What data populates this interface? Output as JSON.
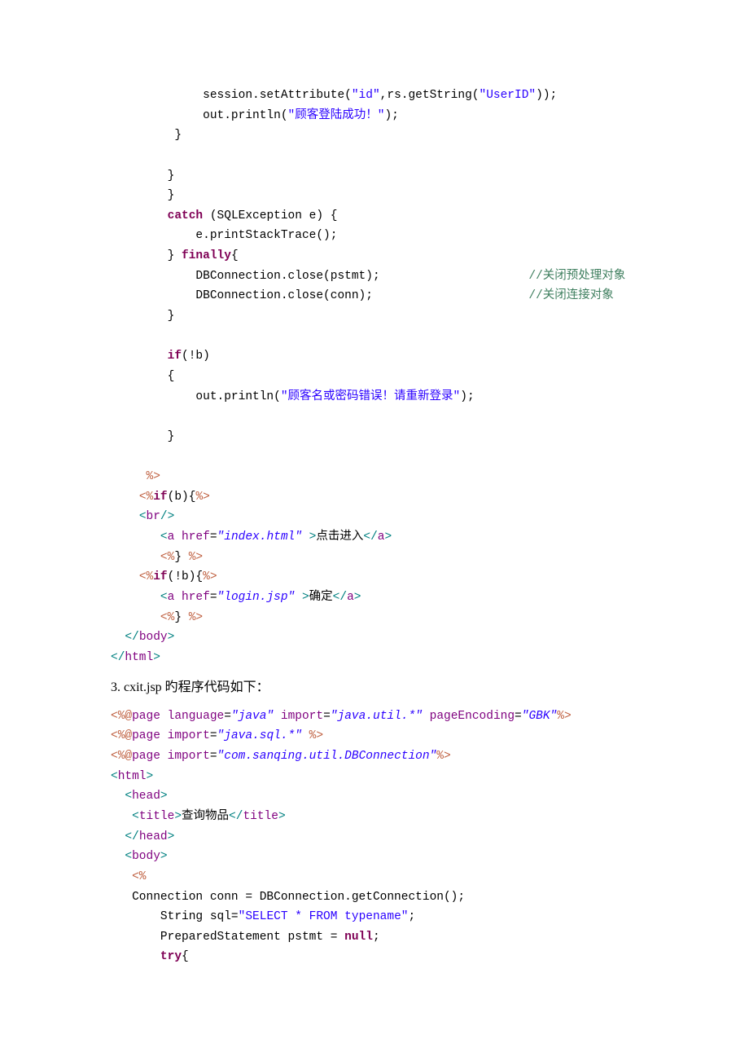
{
  "block1": {
    "l1_a": "             session.setAttribute(",
    "l1_b": "\"id\"",
    "l1_c": ",rs.getString(",
    "l1_d": "\"UserID\"",
    "l1_e": "));",
    "l2_a": "             out.println(",
    "l2_b": "\"顾客登陆成功！\"",
    "l2_c": ");",
    "l3": "         }",
    "l5": "        }",
    "l6": "        }",
    "l7_a": "        ",
    "l7_b": "catch",
    "l7_c": " (SQLException e) {",
    "l8": "            e.printStackTrace();",
    "l9_a": "        } ",
    "l9_b": "finally",
    "l9_c": "{",
    "l10_a": "            DBConnection.close(pstmt);                     ",
    "l10_b": "//关闭预处理对象",
    "l11_a": "            DBConnection.close(conn);                      ",
    "l11_b": "//关闭连接对象",
    "l12": "        }",
    "l14_a": "        ",
    "l14_b": "if",
    "l14_c": "(!b)",
    "l15": "        {",
    "l16_a": "            out.println(",
    "l16_b": "\"顾客名或密码错误！请重新登录\"",
    "l16_c": ");",
    "l18": "        }",
    "l20_a": "     ",
    "l20_b": "%>",
    "l21_a": "    ",
    "l21_b": "<%",
    "l21_c": "if",
    "l21_d": "(b){",
    "l21_e": "%>",
    "l22_a": "    ",
    "l22_b": "<",
    "l22_c": "br",
    "l22_d": "/>",
    "l23_a": "       ",
    "l23_b": "<",
    "l23_c": "a",
    "l23_d": " ",
    "l23_e": "href",
    "l23_f": "=",
    "l23_g": "\"index.html\"",
    "l23_h": " >",
    "l23_i": "点击进入",
    "l23_j": "</",
    "l23_k": "a",
    "l23_l": ">",
    "l24_a": "       ",
    "l24_b": "<%",
    "l24_c": "} ",
    "l24_d": "%>",
    "l25_a": "    ",
    "l25_b": "<%",
    "l25_c": "if",
    "l25_d": "(!b){",
    "l25_e": "%>",
    "l26_a": "       ",
    "l26_b": "<",
    "l26_c": "a",
    "l26_d": " ",
    "l26_e": "href",
    "l26_f": "=",
    "l26_g": "\"login.jsp\"",
    "l26_h": " >",
    "l26_i": "确定",
    "l26_j": "</",
    "l26_k": "a",
    "l26_l": ">",
    "l27_a": "       ",
    "l27_b": "<%",
    "l27_c": "} ",
    "l27_d": "%>",
    "l28_a": "  ",
    "l28_b": "</",
    "l28_c": "body",
    "l28_d": ">",
    "l29_b": "</",
    "l29_c": "html",
    "l29_d": ">"
  },
  "heading": "3. cxit.jsp 旳程序代码如下：",
  "block2": {
    "r1_a": "<%@",
    "r1_b": "page",
    "r1_c": " ",
    "r1_d": "language",
    "r1_e": "=",
    "r1_f": "\"java\"",
    "r1_g": " ",
    "r1_h": "import",
    "r1_i": "=",
    "r1_j": "\"java.util.*\"",
    "r1_k": " ",
    "r1_l": "pageEncoding",
    "r1_m": "=",
    "r1_n": "\"GBK\"",
    "r1_o": "%>",
    "r2_a": "<%@",
    "r2_b": "page",
    "r2_c": " ",
    "r2_d": "import",
    "r2_e": "=",
    "r2_f": "\"java.sql.*\"",
    "r2_g": " ",
    "r2_h": "%>",
    "r3_a": "<%@",
    "r3_b": "page",
    "r3_c": " ",
    "r3_d": "import",
    "r3_e": "=",
    "r3_f": "\"com.sanqing.util.DBConnection\"",
    "r3_g": "%>",
    "r4_a": "<",
    "r4_b": "html",
    "r4_c": ">",
    "r5_a": "  ",
    "r5_b": "<",
    "r5_c": "head",
    "r5_d": ">",
    "r6_a": "   ",
    "r6_b": "<",
    "r6_c": "title",
    "r6_d": ">",
    "r6_e": "查询物品",
    "r6_f": "</",
    "r6_g": "title",
    "r6_h": ">",
    "r7_a": "  ",
    "r7_b": "</",
    "r7_c": "head",
    "r7_d": ">",
    "r8_a": "  ",
    "r8_b": "<",
    "r8_c": "body",
    "r8_d": ">",
    "r9_a": "   ",
    "r9_b": "<%",
    "r10": "   Connection conn = DBConnection.getConnection();",
    "r11_a": "       String sql=",
    "r11_b": "\"SELECT * FROM typename\"",
    "r11_c": ";",
    "r12_a": "       PreparedStatement pstmt = ",
    "r12_b": "null",
    "r12_c": ";",
    "r13_a": "       ",
    "r13_b": "try",
    "r13_c": "{"
  }
}
